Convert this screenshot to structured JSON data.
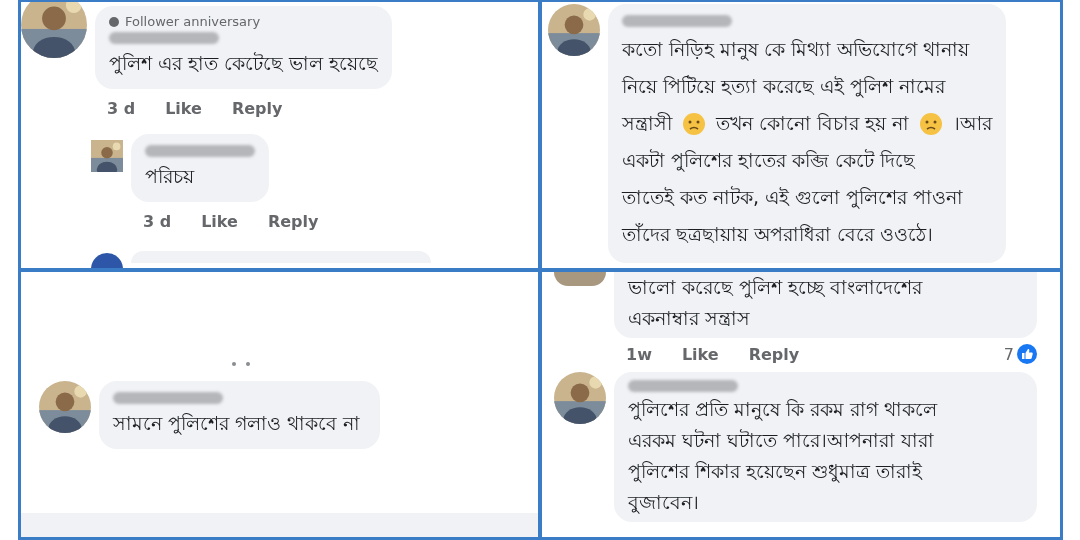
{
  "panels": [
    {
      "items": [
        {
          "kind": "comment",
          "badge": "Follower anniversary",
          "body": [
            [
              {
                "kind": "text",
                "text": "পুলিশ এর হাত কেটেছে ভাল হয়েছে"
              }
            ]
          ],
          "actions": [
            "3 d",
            "Like",
            "Reply"
          ],
          "replies": [
            {
              "kind": "comment",
              "body": [
                [
                  {
                    "kind": "text",
                    "text": "পরিচয়"
                  }
                ]
              ],
              "actions": [
                "3 d",
                "Like",
                "Reply"
              ]
            },
            {
              "kind": "cut_bottom"
            }
          ]
        }
      ]
    },
    {
      "items": [
        {
          "kind": "comment",
          "body": [
            [
              {
                "kind": "text",
                "text": "কতো নিড়িহ মানুষ কে মিথ্যা অভিযোগে থানায়"
              }
            ],
            [
              {
                "kind": "text",
                "text": "নিয়ে পিটিয়ে হত্যা করেছে এই পুলিশ নামের"
              }
            ],
            [
              {
                "kind": "text",
                "text": "সন্ত্রাসী"
              },
              {
                "kind": "emoji"
              },
              {
                "kind": "text",
                "text": "তখন কোনো বিচার হয় না"
              },
              {
                "kind": "emoji"
              },
              {
                "kind": "text",
                "text": "।আর"
              }
            ],
            [
              {
                "kind": "text",
                "text": "একটা পুলিশের হাতের কব্জি কেটে দিছে"
              }
            ],
            [
              {
                "kind": "text",
                "text": "তাতেই কত নাটক, এই গুলো পুলিশের পাওনা"
              }
            ],
            [
              {
                "kind": "text",
                "text": "তাঁদের ছত্রছায়ায় অপরাধিরা বেরে ওওঠে।"
              }
            ]
          ]
        }
      ]
    },
    {
      "items": [
        {
          "kind": "dots"
        },
        {
          "kind": "comment",
          "body": [
            [
              {
                "kind": "text",
                "text": "সামনে পুলিশের গলাও  থাকবে না"
              }
            ]
          ]
        },
        {
          "kind": "bar"
        }
      ]
    },
    {
      "items": [
        {
          "kind": "cut_top",
          "body": [
            [
              {
                "kind": "text",
                "text": "ভালো করেছে পুলিশ হচ্ছে বাংলাদেশের"
              }
            ],
            [
              {
                "kind": "text",
                "text": "একনাম্বার সন্ত্রাস"
              }
            ]
          ],
          "actions": [
            "1w",
            "Like",
            "Reply"
          ],
          "reactions": "7"
        },
        {
          "kind": "comment",
          "body": [
            [
              {
                "kind": "text",
                "text": "পুলিশের প্রতি মানুষে কি রকম রাগ থাকলে"
              }
            ],
            [
              {
                "kind": "text",
                "text": "এরকম ঘটনা ঘটাতে পারে।আপনারা যারা"
              }
            ],
            [
              {
                "kind": "text",
                "text": "পুলিশের শিকার হয়েছেন শুধুমাত্র তারাই"
              }
            ],
            [
              {
                "kind": "text",
                "text": "বুজাবেন।"
              }
            ]
          ]
        }
      ]
    }
  ]
}
